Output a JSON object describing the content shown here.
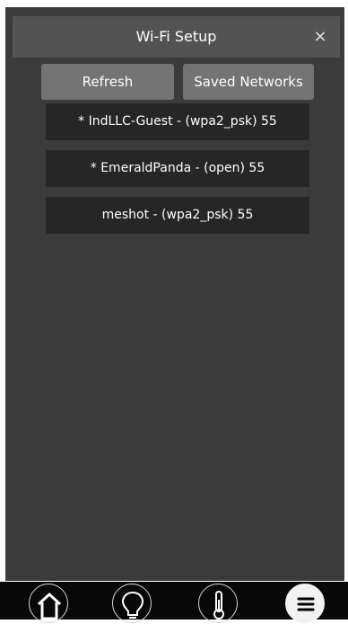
{
  "header": {
    "title": "Wi-Fi Setup",
    "close_symbol": "×"
  },
  "actions": {
    "refresh_label": "Refresh",
    "saved_label": "Saved Networks"
  },
  "networks": [
    {
      "label": "* IndLLC-Guest - (wpa2_psk) 55"
    },
    {
      "label": "* EmeraldPanda - (open) 55"
    },
    {
      "label": "meshot - (wpa2_psk) 55"
    }
  ],
  "bottom_nav": {
    "icons": [
      "home-icon",
      "lightbulb-icon",
      "thermometer-icon",
      "menu-icon"
    ]
  },
  "colors": {
    "screen": "#3b3b3b",
    "header": "#535353",
    "button": "#747474",
    "network_row": "#262626",
    "nav_bar": "#080808"
  }
}
